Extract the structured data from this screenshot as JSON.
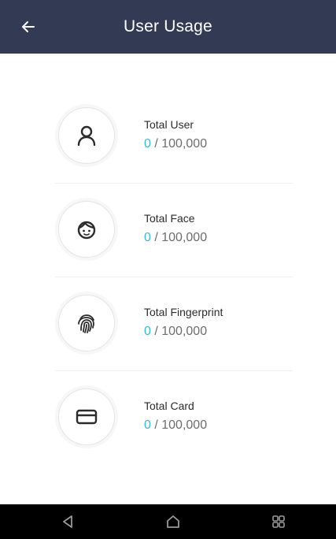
{
  "header": {
    "title": "User Usage",
    "back_icon": "back-arrow-icon",
    "background": "#323a54"
  },
  "usage": [
    {
      "label": "Total User",
      "used": "0",
      "separator": " / ",
      "total": "100,000",
      "icon": "user-icon"
    },
    {
      "label": "Total Face",
      "used": "0",
      "separator": " / ",
      "total": "100,000",
      "icon": "face-icon"
    },
    {
      "label": "Total Fingerprint",
      "used": "0",
      "separator": " / ",
      "total": "100,000",
      "icon": "fingerprint-icon"
    },
    {
      "label": "Total Card",
      "used": "0",
      "separator": " / ",
      "total": "100,000",
      "icon": "card-icon"
    }
  ],
  "accent_color": "#33bcd6",
  "navbar": {
    "buttons": [
      "back-triangle-icon",
      "home-icon",
      "recents-icon"
    ]
  }
}
